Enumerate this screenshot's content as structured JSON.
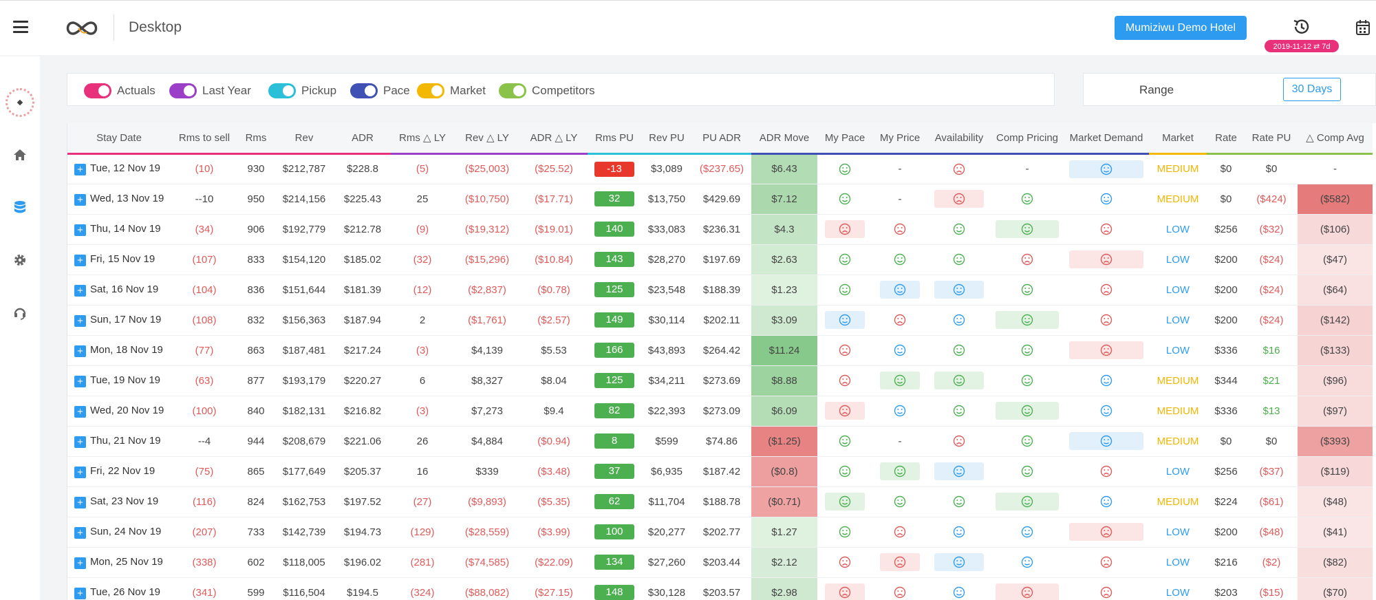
{
  "header": {
    "page_title": "Desktop",
    "hotel_button": "Mumiziwu Demo Hotel",
    "date_badge": "2019-11-12 ⇄ 7d",
    "icons": [
      "menu-icon",
      "logo-infinity-icon",
      "history-icon",
      "calendar-icon"
    ]
  },
  "sidebar": {
    "icons": [
      "avatar",
      "home-icon",
      "database-icon",
      "gear-icon",
      "headset-icon"
    ],
    "active": "database-icon",
    "accent": "#2d9cf0"
  },
  "filters": [
    {
      "label": "Actuals",
      "color": "#e8317a"
    },
    {
      "label": "Last Year",
      "color": "#9b3fc8"
    },
    {
      "label": "Pickup",
      "color": "#2cc0d8"
    },
    {
      "label": "Pace",
      "color": "#3f51b5"
    },
    {
      "label": "Market",
      "color": "#f5b800"
    },
    {
      "label": "Competitors",
      "color": "#8bc34a"
    }
  ],
  "range": {
    "label": "Range",
    "button": "30 Days"
  },
  "table": {
    "columns": [
      "Stay Date",
      "Rms to sell",
      "Rms",
      "Rev",
      "ADR",
      "Rms △ LY",
      "Rev △ LY",
      "ADR △ LY",
      "Rms PU",
      "Rev PU",
      "PU ADR",
      "ADR Move",
      "My Pace",
      "My Price",
      "Availability",
      "Comp Pricing",
      "Market Demand",
      "Market",
      "Rate",
      "Rate PU",
      "△ Comp Avg"
    ],
    "header_colors": [
      "#e8317a",
      "#e8317a",
      "#e8317a",
      "#e8317a",
      "#e8317a",
      "#9b3fc8",
      "#9b3fc8",
      "#9b3fc8",
      "#2cc0d8",
      "#2cc0d8",
      "#2cc0d8",
      "#3f51b5",
      "#3f51b5",
      "#3f51b5",
      "#3f51b5",
      "#3f51b5",
      "#3f51b5",
      "#f5b800",
      "#8bc34a",
      "#8bc34a",
      "#8bc34a"
    ],
    "rows": [
      {
        "date": "Tue, 12 Nov 19",
        "rts": "(10)",
        "rms": "930",
        "rev": "$212,787",
        "adr": "$228.8",
        "rms_ly": "(5)",
        "rev_ly": "($25,003)",
        "adr_ly": "($25.52)",
        "rms_pu": "-13",
        "rev_pu": "$3,089",
        "pu_adr": "($237.65)",
        "adr_move": "$6.43",
        "pace": "happy",
        "price": "-",
        "avail": "sad",
        "comp": "-",
        "demand": "neutral",
        "market": "MEDIUM",
        "rate": "$0",
        "rate_pu": "$0",
        "comp_avg": "-"
      },
      {
        "date": "Wed, 13 Nov 19",
        "rts": "--10",
        "rms": "950",
        "rev": "$214,156",
        "adr": "$225.43",
        "rms_ly": "25",
        "rev_ly": "($10,750)",
        "adr_ly": "($17.71)",
        "rms_pu": "32",
        "rev_pu": "$13,750",
        "pu_adr": "$429.69",
        "adr_move": "$7.12",
        "pace": "happy",
        "price": "-",
        "avail": "sad",
        "comp": "happy",
        "demand": "neutral",
        "market": "MEDIUM",
        "rate": "$0",
        "rate_pu": "($424)",
        "comp_avg": "($582)"
      },
      {
        "date": "Thu, 14 Nov 19",
        "rts": "(34)",
        "rms": "906",
        "rev": "$192,779",
        "adr": "$212.78",
        "rms_ly": "(9)",
        "rev_ly": "($19,312)",
        "adr_ly": "($19.01)",
        "rms_pu": "140",
        "rev_pu": "$33,083",
        "pu_adr": "$236.31",
        "adr_move": "$4.3",
        "pace": "sad",
        "price": "sad",
        "avail": "happy",
        "comp": "happy",
        "demand": "sad",
        "market": "LOW",
        "rate": "$256",
        "rate_pu": "($32)",
        "comp_avg": "($106)"
      },
      {
        "date": "Fri, 15 Nov 19",
        "rts": "(107)",
        "rms": "833",
        "rev": "$154,120",
        "adr": "$185.02",
        "rms_ly": "(32)",
        "rev_ly": "($15,296)",
        "adr_ly": "($10.84)",
        "rms_pu": "143",
        "rev_pu": "$28,270",
        "pu_adr": "$197.69",
        "adr_move": "$2.63",
        "pace": "happy",
        "price": "happy",
        "avail": "happy",
        "comp": "sad",
        "demand": "sad",
        "market": "LOW",
        "rate": "$200",
        "rate_pu": "($24)",
        "comp_avg": "($47)"
      },
      {
        "date": "Sat, 16 Nov 19",
        "rts": "(104)",
        "rms": "836",
        "rev": "$151,644",
        "adr": "$181.39",
        "rms_ly": "(12)",
        "rev_ly": "($2,837)",
        "adr_ly": "($0.78)",
        "rms_pu": "125",
        "rev_pu": "$23,548",
        "pu_adr": "$188.39",
        "adr_move": "$1.23",
        "pace": "happy",
        "price": "neutral",
        "avail": "neutral",
        "comp": "happy",
        "demand": "sad",
        "market": "LOW",
        "rate": "$200",
        "rate_pu": "($24)",
        "comp_avg": "($64)"
      },
      {
        "date": "Sun, 17 Nov 19",
        "rts": "(108)",
        "rms": "832",
        "rev": "$156,363",
        "adr": "$187.94",
        "rms_ly": "2",
        "rev_ly": "($1,761)",
        "adr_ly": "($2.57)",
        "rms_pu": "149",
        "rev_pu": "$30,114",
        "pu_adr": "$202.11",
        "adr_move": "$3.09",
        "pace": "neutral",
        "price": "sad",
        "avail": "neutral",
        "comp": "happy",
        "demand": "sad",
        "market": "LOW",
        "rate": "$200",
        "rate_pu": "($24)",
        "comp_avg": "($142)"
      },
      {
        "date": "Mon, 18 Nov 19",
        "rts": "(77)",
        "rms": "863",
        "rev": "$187,481",
        "adr": "$217.24",
        "rms_ly": "(3)",
        "rev_ly": "$4,139",
        "adr_ly": "$5.53",
        "rms_pu": "166",
        "rev_pu": "$43,893",
        "pu_adr": "$264.42",
        "adr_move": "$11.24",
        "pace": "sad",
        "price": "neutral",
        "avail": "happy",
        "comp": "happy",
        "demand": "sad",
        "market": "LOW",
        "rate": "$336",
        "rate_pu": "$16",
        "comp_avg": "($133)"
      },
      {
        "date": "Tue, 19 Nov 19",
        "rts": "(63)",
        "rms": "877",
        "rev": "$193,179",
        "adr": "$220.27",
        "rms_ly": "6",
        "rev_ly": "$8,327",
        "adr_ly": "$8.04",
        "rms_pu": "125",
        "rev_pu": "$34,211",
        "pu_adr": "$273.69",
        "adr_move": "$8.88",
        "pace": "sad",
        "price": "happy",
        "avail": "happy",
        "comp": "happy",
        "demand": "neutral",
        "market": "MEDIUM",
        "rate": "$344",
        "rate_pu": "$21",
        "comp_avg": "($96)"
      },
      {
        "date": "Wed, 20 Nov 19",
        "rts": "(100)",
        "rms": "840",
        "rev": "$182,131",
        "adr": "$216.82",
        "rms_ly": "(3)",
        "rev_ly": "$7,273",
        "adr_ly": "$9.4",
        "rms_pu": "82",
        "rev_pu": "$22,393",
        "pu_adr": "$273.09",
        "adr_move": "$6.09",
        "pace": "sad",
        "price": "neutral",
        "avail": "happy",
        "comp": "happy",
        "demand": "neutral",
        "market": "MEDIUM",
        "rate": "$336",
        "rate_pu": "$13",
        "comp_avg": "($97)"
      },
      {
        "date": "Thu, 21 Nov 19",
        "rts": "--4",
        "rms": "944",
        "rev": "$208,679",
        "adr": "$221.06",
        "rms_ly": "26",
        "rev_ly": "$4,884",
        "adr_ly": "($0.94)",
        "rms_pu": "8",
        "rev_pu": "$599",
        "pu_adr": "$74.86",
        "adr_move": "($1.25)",
        "pace": "happy",
        "price": "-",
        "avail": "sad",
        "comp": "happy",
        "demand": "neutral",
        "market": "MEDIUM",
        "rate": "$0",
        "rate_pu": "$0",
        "comp_avg": "($393)"
      },
      {
        "date": "Fri, 22 Nov 19",
        "rts": "(75)",
        "rms": "865",
        "rev": "$177,649",
        "adr": "$205.37",
        "rms_ly": "16",
        "rev_ly": "$339",
        "adr_ly": "($3.48)",
        "rms_pu": "37",
        "rev_pu": "$6,935",
        "pu_adr": "$187.42",
        "adr_move": "($0.8)",
        "pace": "happy",
        "price": "happy",
        "avail": "neutral",
        "comp": "happy",
        "demand": "sad",
        "market": "LOW",
        "rate": "$256",
        "rate_pu": "($37)",
        "comp_avg": "($119)"
      },
      {
        "date": "Sat, 23 Nov 19",
        "rts": "(116)",
        "rms": "824",
        "rev": "$162,753",
        "adr": "$197.52",
        "rms_ly": "(27)",
        "rev_ly": "($9,893)",
        "adr_ly": "($5.35)",
        "rms_pu": "62",
        "rev_pu": "$11,704",
        "pu_adr": "$188.78",
        "adr_move": "($0.71)",
        "pace": "happy",
        "price": "happy",
        "avail": "happy",
        "comp": "happy",
        "demand": "neutral",
        "market": "MEDIUM",
        "rate": "$224",
        "rate_pu": "($61)",
        "comp_avg": "($48)"
      },
      {
        "date": "Sun, 24 Nov 19",
        "rts": "(207)",
        "rms": "733",
        "rev": "$142,739",
        "adr": "$194.73",
        "rms_ly": "(129)",
        "rev_ly": "($28,559)",
        "adr_ly": "($3.99)",
        "rms_pu": "100",
        "rev_pu": "$20,277",
        "pu_adr": "$202.77",
        "adr_move": "$1.27",
        "pace": "happy",
        "price": "sad",
        "avail": "neutral",
        "comp": "neutral",
        "demand": "sad",
        "market": "LOW",
        "rate": "$200",
        "rate_pu": "($48)",
        "comp_avg": "($41)"
      },
      {
        "date": "Mon, 25 Nov 19",
        "rts": "(338)",
        "rms": "602",
        "rev": "$118,005",
        "adr": "$196.02",
        "rms_ly": "(281)",
        "rev_ly": "($74,585)",
        "adr_ly": "($22.09)",
        "rms_pu": "134",
        "rev_pu": "$27,260",
        "pu_adr": "$203.44",
        "adr_move": "$2.12",
        "pace": "sad",
        "price": "sad",
        "avail": "neutral",
        "comp": "neutral",
        "demand": "sad",
        "market": "LOW",
        "rate": "$216",
        "rate_pu": "($2)",
        "comp_avg": "($82)"
      },
      {
        "date": "Tue, 26 Nov 19",
        "rts": "(341)",
        "rms": "599",
        "rev": "$116,504",
        "adr": "$194.5",
        "rms_ly": "(324)",
        "rev_ly": "($88,082)",
        "adr_ly": "($27.15)",
        "rms_pu": "148",
        "rev_pu": "$30,128",
        "pu_adr": "$203.57",
        "adr_move": "$2.98",
        "pace": "sad",
        "price": "sad",
        "avail": "neutral",
        "comp": "sad",
        "demand": "sad",
        "market": "LOW",
        "rate": "$203",
        "rate_pu": "($15)",
        "comp_avg": "($70)"
      }
    ]
  }
}
